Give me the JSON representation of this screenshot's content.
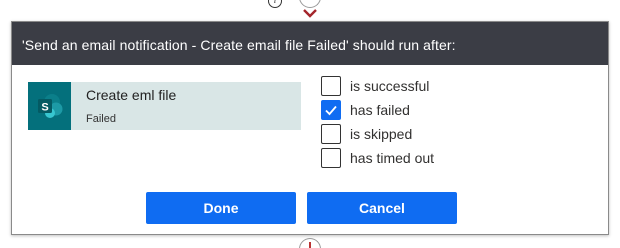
{
  "dialog": {
    "title": "'Send an email notification - Create email file Failed' should run after:"
  },
  "action": {
    "title": "Create eml file",
    "status": "Failed",
    "icon": "sharepoint-icon",
    "icon_color": "#04707c",
    "card_color": "#d9e6e6"
  },
  "run_after_options": [
    {
      "label": "is successful",
      "checked": false
    },
    {
      "label": "has failed",
      "checked": true
    },
    {
      "label": "is skipped",
      "checked": false
    },
    {
      "label": "has timed out",
      "checked": false
    }
  ],
  "buttons": {
    "done_label": "Done",
    "cancel_label": "Cancel"
  },
  "colors": {
    "header_bg": "#3b3d45",
    "primary_button": "#0f6cf2",
    "connector_arrow": "#a4262c"
  }
}
